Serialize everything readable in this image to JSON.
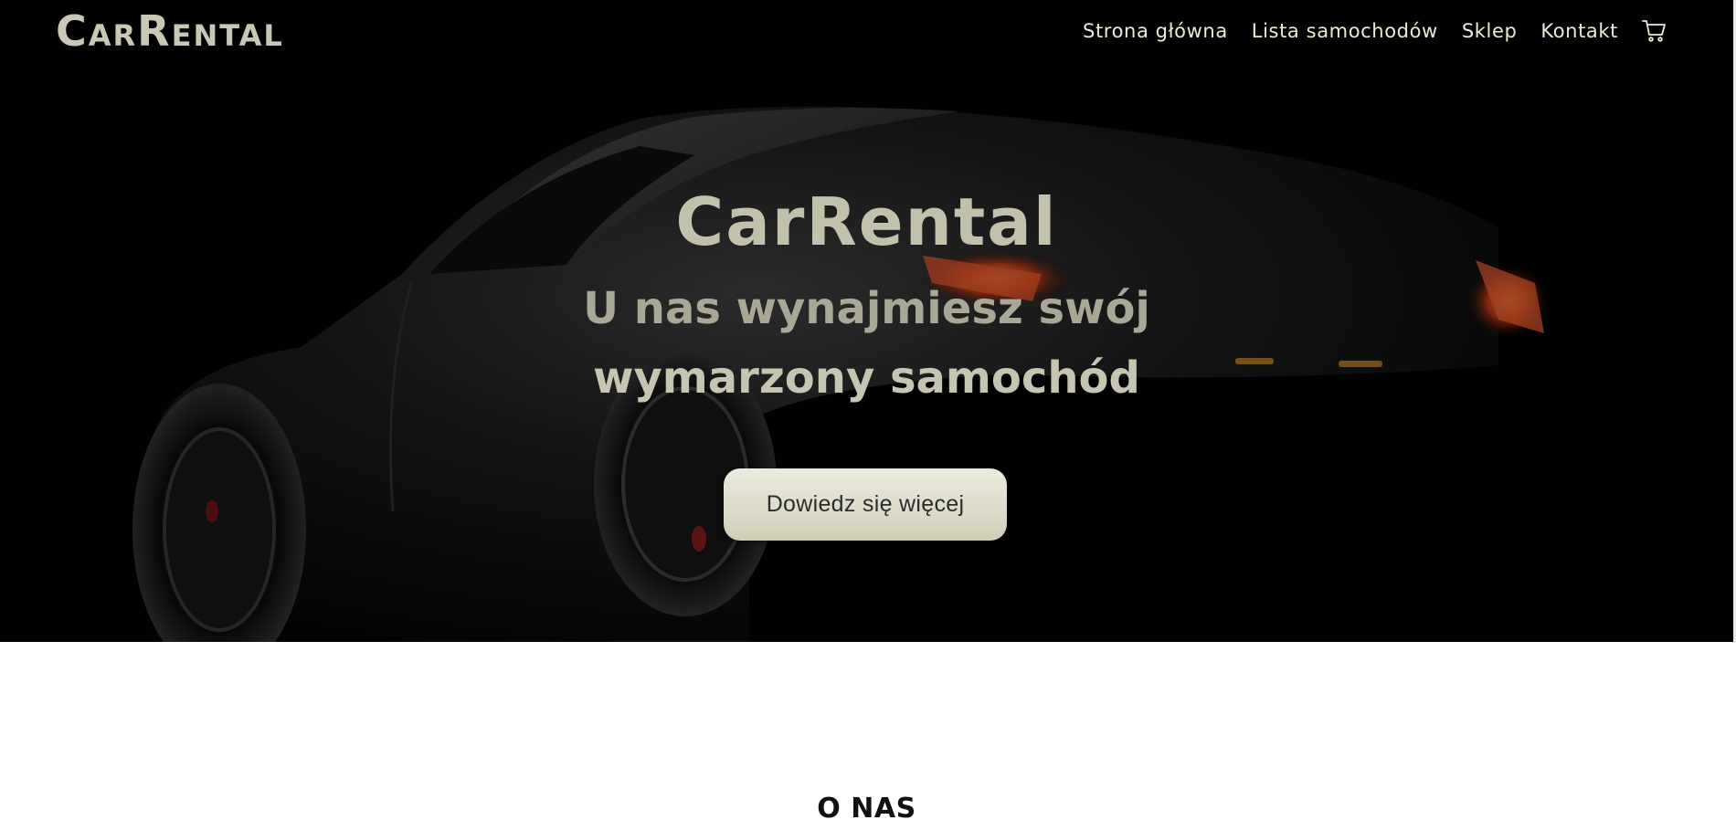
{
  "navbar": {
    "logo": "CarRental",
    "links": [
      {
        "label": "Strona główna"
      },
      {
        "label": "Lista samochodów"
      },
      {
        "label": "Sklep"
      },
      {
        "label": "Kontakt"
      }
    ],
    "cart_icon": "shopping-cart-icon"
  },
  "hero": {
    "title": "CarRental",
    "subtitle_line1": "U nas wynajmiesz swój",
    "subtitle_line2": "wymarzony samochód",
    "cta_label": "Dowiedz się więcej",
    "background": "dark sports car photo",
    "colors": {
      "text": "#c2c1ac",
      "nav_text": "#ecebd6",
      "button_bg": "#dcdbc8"
    }
  },
  "about": {
    "heading": "O NAS"
  }
}
